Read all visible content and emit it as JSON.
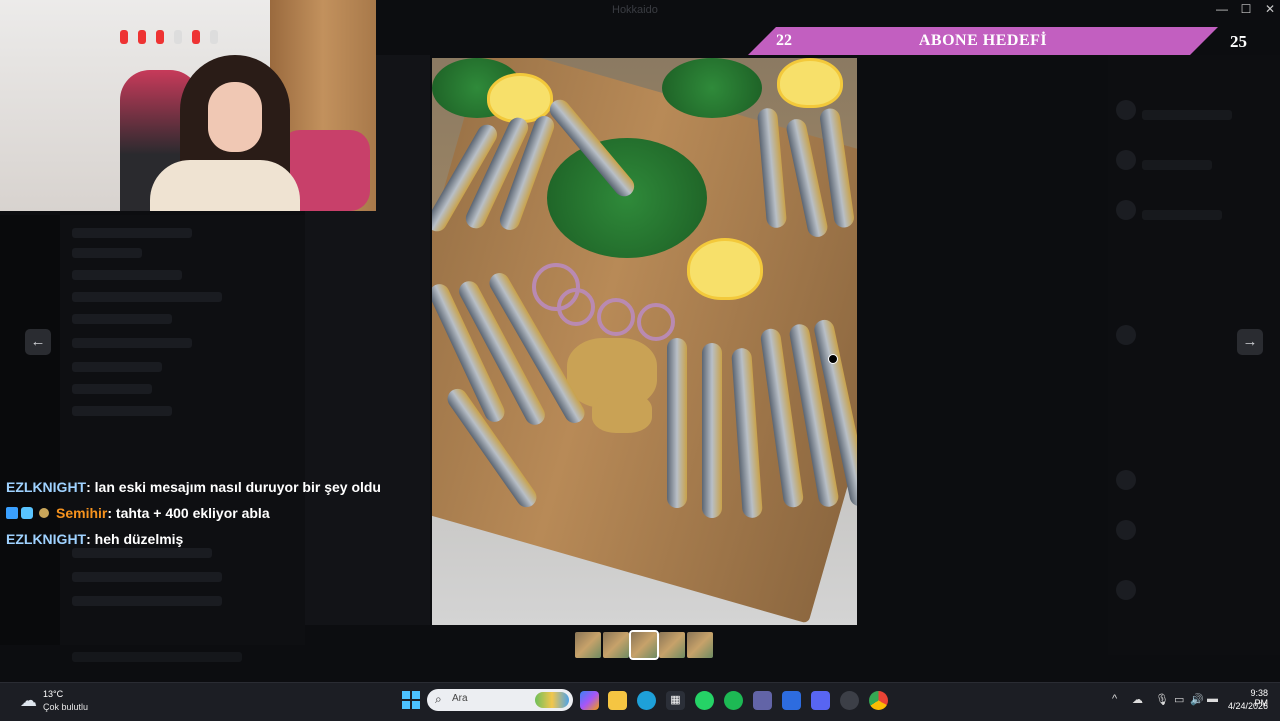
{
  "window": {
    "title": "Hokkaido"
  },
  "goal": {
    "current": "22",
    "label": "ABONE HEDEFİ",
    "target": "25"
  },
  "chat": [
    {
      "user": "EZLKNIGHT",
      "message": " : lan eski mesajım nasıl duruyor bir şey oldu",
      "user_color": "#9fd2ff"
    },
    {
      "user": "Semihir",
      "message": " : tahta + 400 ekliyor abla",
      "user_color": "#f7931e"
    },
    {
      "user": "EZLKNIGHT",
      "message": " : heh düzelmiş",
      "user_color": "#9fd2ff"
    }
  ],
  "viewer": {
    "prev_icon": "arrow-left-icon",
    "next_icon": "arrow-right-icon",
    "thumbnail_count": 5,
    "active_thumbnail": 3
  },
  "taskbar": {
    "weather_temp": "13°C",
    "weather_desc": "Çok bulutlu",
    "search_placeholder": "Ara",
    "time": "9:38 PM",
    "date": "4/24/2026"
  },
  "colors": {
    "goal_banner": "#c25fc0",
    "accent": "#4cc2ff"
  }
}
